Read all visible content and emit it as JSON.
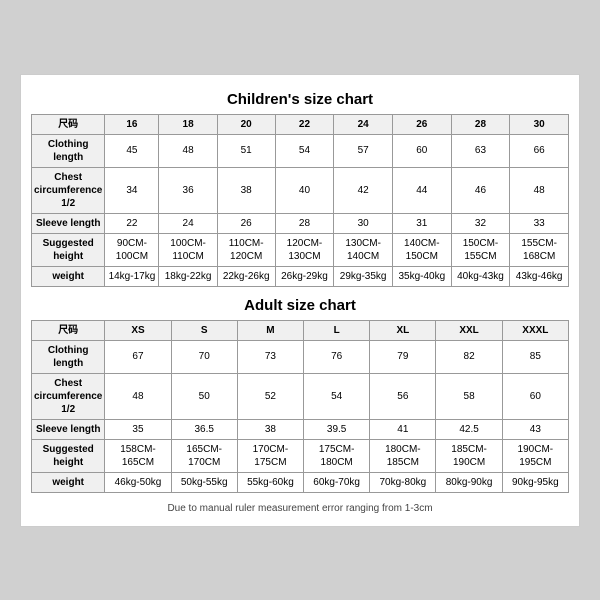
{
  "children_chart": {
    "title": "Children's size chart",
    "columns": [
      "尺码",
      "16",
      "18",
      "20",
      "22",
      "24",
      "26",
      "28",
      "30"
    ],
    "rows": [
      {
        "label": "Clothing length",
        "values": [
          "45",
          "48",
          "51",
          "54",
          "57",
          "60",
          "63",
          "66"
        ]
      },
      {
        "label": "Chest circumference 1/2",
        "values": [
          "34",
          "36",
          "38",
          "40",
          "42",
          "44",
          "46",
          "48"
        ]
      },
      {
        "label": "Sleeve length",
        "values": [
          "22",
          "24",
          "26",
          "28",
          "30",
          "31",
          "32",
          "33"
        ]
      },
      {
        "label": "Suggested height",
        "values": [
          "90CM-100CM",
          "100CM-110CM",
          "110CM-120CM",
          "120CM-130CM",
          "130CM-140CM",
          "140CM-150CM",
          "150CM-155CM",
          "155CM-168CM"
        ]
      },
      {
        "label": "weight",
        "values": [
          "14kg-17kg",
          "18kg-22kg",
          "22kg-26kg",
          "26kg-29kg",
          "29kg-35kg",
          "35kg-40kg",
          "40kg-43kg",
          "43kg-46kg"
        ]
      }
    ]
  },
  "adult_chart": {
    "title": "Adult size chart",
    "columns": [
      "尺码",
      "XS",
      "S",
      "M",
      "L",
      "XL",
      "XXL",
      "XXXL"
    ],
    "rows": [
      {
        "label": "Clothing length",
        "values": [
          "67",
          "70",
          "73",
          "76",
          "79",
          "82",
          "85"
        ]
      },
      {
        "label": "Chest circumference 1/2",
        "values": [
          "48",
          "50",
          "52",
          "54",
          "56",
          "58",
          "60"
        ]
      },
      {
        "label": "Sleeve length",
        "values": [
          "35",
          "36.5",
          "38",
          "39.5",
          "41",
          "42.5",
          "43"
        ]
      },
      {
        "label": "Suggested height",
        "values": [
          "158CM-165CM",
          "165CM-170CM",
          "170CM-175CM",
          "175CM-180CM",
          "180CM-185CM",
          "185CM-190CM",
          "190CM-195CM"
        ]
      },
      {
        "label": "weight",
        "values": [
          "46kg-50kg",
          "50kg-55kg",
          "55kg-60kg",
          "60kg-70kg",
          "70kg-80kg",
          "80kg-90kg",
          "90kg-95kg"
        ]
      }
    ]
  },
  "footer": "Due to manual ruler measurement error ranging from 1-3cm"
}
